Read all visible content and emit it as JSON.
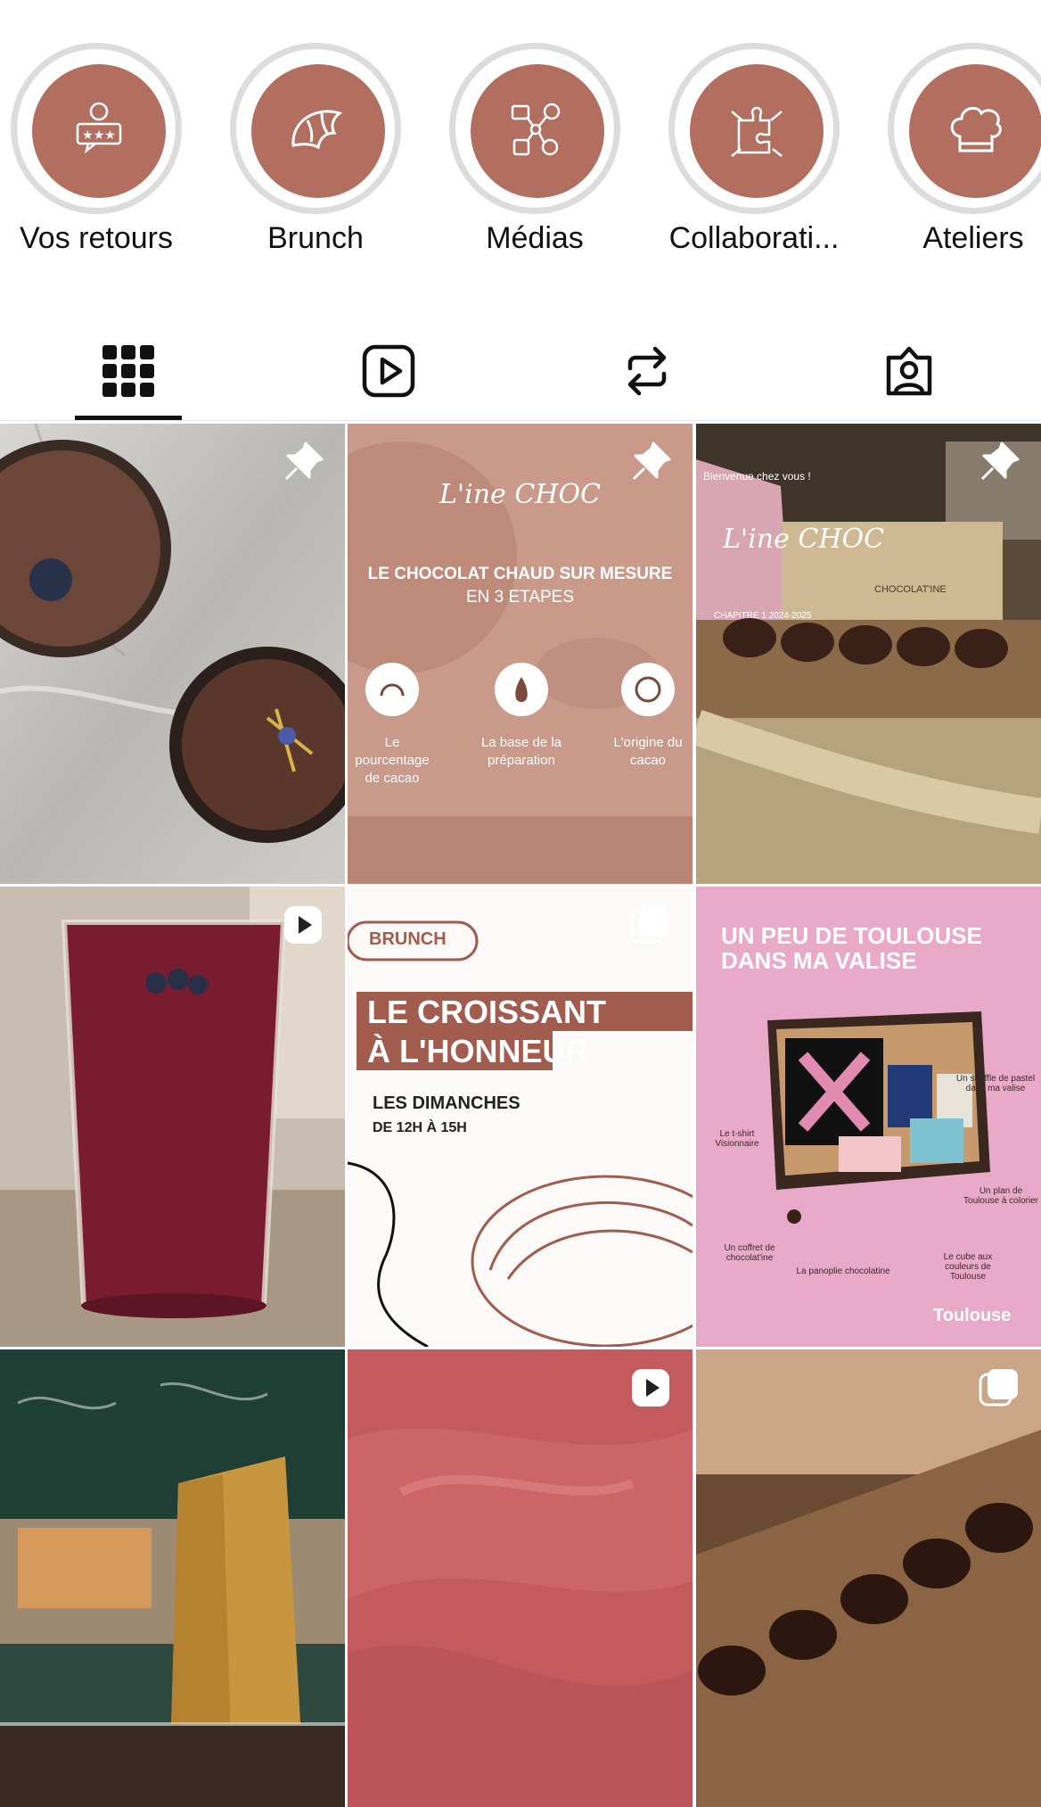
{
  "highlights": [
    {
      "label": "Vos retours",
      "icon": "review-stars-icon"
    },
    {
      "label": "Brunch",
      "icon": "croissant-icon"
    },
    {
      "label": "Médias",
      "icon": "media-network-icon"
    },
    {
      "label": "Collaborati...",
      "icon": "puzzle-hands-icon"
    },
    {
      "label": "Ateliers",
      "icon": "chef-hat-icon"
    }
  ],
  "highlight_logo": "L'ine CHOC",
  "tabs": [
    {
      "name": "posts",
      "icon": "grid-icon",
      "active": true
    },
    {
      "name": "reels",
      "icon": "reels-icon",
      "active": false
    },
    {
      "name": "reposts",
      "icon": "repost-icon",
      "active": false
    },
    {
      "name": "tagged",
      "icon": "tagged-person-icon",
      "active": false
    }
  ],
  "posts": {
    "p2": {
      "logo": "L'ine CHOC",
      "title": "LE CHOCOLAT CHAUD SUR MESURE",
      "subtitle": "EN 3 ETAPES",
      "step1": "Le pourcentage de cacao",
      "step2": "La base de la préparation",
      "step3": "L'origine du cacao"
    },
    "p3": {
      "card_text": "Bienvenue chez vous !",
      "logo": "L'ine CHOC",
      "box_label": "CHOCOLAT'INE",
      "card_small": "CHAPITRE 1 2024-2025"
    },
    "p5": {
      "tag": "BRUNCH",
      "title_line1": "LE CROISSANT",
      "title_line2": "À L'HONNEUR",
      "line1": "LES DIMANCHES",
      "line2": "DE 12H À 15H"
    },
    "p6": {
      "title_line1": "UN PEU DE TOULOUSE",
      "title_line2": "DANS MA VALISE",
      "label_tshirt": "Le t-shirt Visionnaire",
      "label_pastel": "Un souffle de pastel dans ma valise",
      "label_coffret": "Un coffret de chocolat'ine",
      "label_panoplie": "La panoplie chocolatine",
      "label_plan": "Un plan de Toulouse à colorier",
      "label_cube": "Le cube aux couleurs de Toulouse",
      "brand": "Toulouse"
    }
  },
  "colors": {
    "highlight_bg": "#b26f5f",
    "ring": "#dcdcdc",
    "p6_bg": "#e9a9c8",
    "p5_accent": "#a15c4d"
  }
}
